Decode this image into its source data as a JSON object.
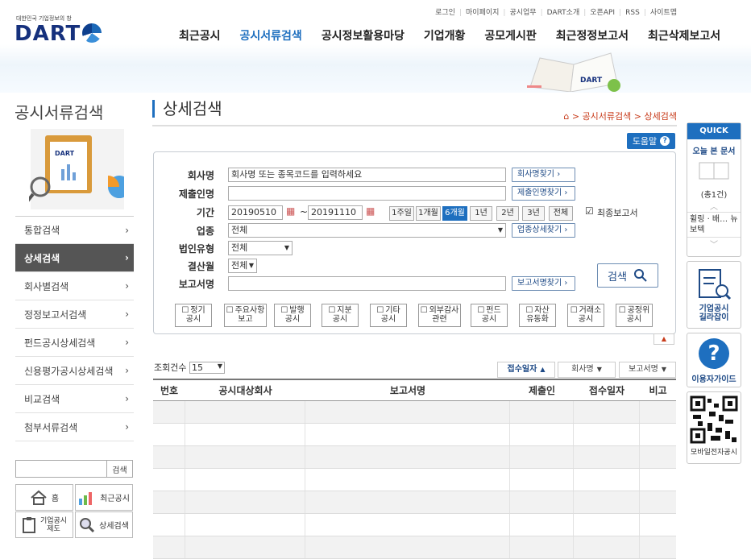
{
  "header": {
    "tagline": "대한민국 기업정보의 창",
    "logo": "DART",
    "util_links": [
      "로그인",
      "마이페이지",
      "공시업무",
      "DART소개",
      "오픈API",
      "RSS",
      "사이트맵"
    ],
    "gnb": [
      "최근공시",
      "공시서류검색",
      "공시정보활용마당",
      "기업개황",
      "공모게시판",
      "최근정정보고서",
      "최근삭제보고서"
    ],
    "gnb_active": "공시서류검색",
    "banner_book_logo": "DART"
  },
  "sidebar": {
    "title": "공시서류검색",
    "clipboard_logo": "DART",
    "items": [
      {
        "label": "통합검색",
        "arrow": "›"
      },
      {
        "label": "상세검색",
        "arrow": "›",
        "active": true
      },
      {
        "label": "회사별검색",
        "arrow": "›"
      },
      {
        "label": "정정보고서검색",
        "arrow": "›"
      },
      {
        "label": "펀드공시상세검색",
        "arrow": "›"
      },
      {
        "label": "신용평가공시상세검색",
        "arrow": "›"
      },
      {
        "label": "비교검색",
        "arrow": "›"
      },
      {
        "label": "첨부서류검색",
        "arrow": "›"
      }
    ],
    "search_button": "검색",
    "quick_buttons": [
      {
        "label": "홈",
        "icon": "home-icon"
      },
      {
        "label": "최근공시",
        "icon": "bar-chart-icon"
      },
      {
        "label": "기업공시\n제도",
        "icon": "clipboard-icon"
      },
      {
        "label": "상세검색",
        "icon": "magnifier-icon"
      }
    ]
  },
  "main": {
    "title": "상세검색",
    "breadcrumb": [
      "공시서류검색",
      "상세검색"
    ],
    "breadcrumb_sep": ">",
    "help_button": "도움말",
    "form": {
      "company_label": "회사명",
      "company_placeholder": "회사명 또는 종목코드를 입력하세요",
      "company_find": "회사명찾기",
      "submitter_label": "제출인명",
      "submitter_value": "",
      "submitter_find": "제출인명찾기",
      "period_label": "기간",
      "date_from": "20190510",
      "date_sep": "~",
      "date_to": "20191110",
      "period_buttons": [
        "1주일",
        "1개월",
        "6개월",
        "1년",
        "2년",
        "3년",
        "전체"
      ],
      "period_active": "6개월",
      "final_report_label": "최종보고서",
      "final_report_checked": true,
      "industry_label": "업종",
      "industry_value": "전체",
      "industry_find": "업종상세찾기",
      "corp_type_label": "법인유형",
      "corp_type_value": "전체",
      "settlement_label": "결산월",
      "settlement_value": "전체",
      "report_label": "보고서명",
      "report_value": "",
      "report_find": "보고서명찾기",
      "search_button": "검색",
      "arrow_mark": "›",
      "categories": [
        [
          "정기",
          "공시"
        ],
        [
          "주요사항",
          "보고"
        ],
        [
          "발행",
          "공시"
        ],
        [
          "지분",
          "공시"
        ],
        [
          "기타",
          "공시"
        ],
        [
          "외부감사",
          "관련"
        ],
        [
          "펀드",
          "공시"
        ],
        [
          "자산",
          "유동화"
        ],
        [
          "거래소",
          "공시"
        ],
        [
          "공정위",
          "공시"
        ]
      ]
    },
    "count_label": "조회건수",
    "count_value": "15",
    "sort_buttons": [
      {
        "label": "접수일자",
        "arrow": "▲",
        "active": true
      },
      {
        "label": "회사명",
        "arrow": "▼"
      },
      {
        "label": "보고서명",
        "arrow": "▼"
      }
    ],
    "table": {
      "headers": [
        "번호",
        "공시대상회사",
        "보고서명",
        "제출인",
        "접수일자",
        "비고"
      ],
      "rows": [
        [],
        [],
        [],
        [],
        [],
        [],
        []
      ]
    }
  },
  "quick": {
    "title": "QUICK",
    "today_docs": "오늘 본 문서",
    "today_count": "(총1건)",
    "today_item": "휠링 · 배… 뉴보텍",
    "guide_company": "기업공시\n길라잡이",
    "user_guide": "이용자가이드",
    "mobile": "모바일전자공시"
  },
  "colors": {
    "accent": "#1e6fbf",
    "active_nav": "#555555",
    "breadcrumb": "#c83c1b"
  }
}
